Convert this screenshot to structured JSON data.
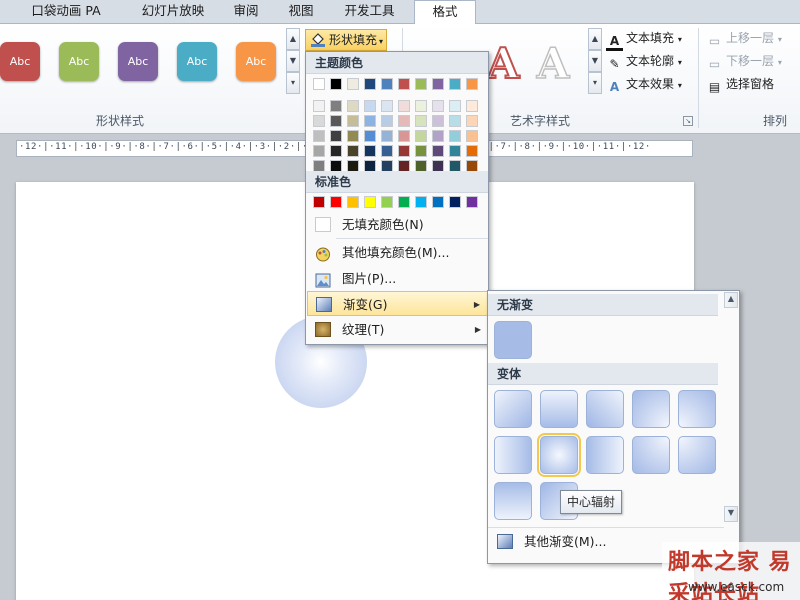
{
  "tabs": [
    {
      "label": "口袋动画 PA",
      "active": false
    },
    {
      "label": "幻灯片放映",
      "active": false
    },
    {
      "label": "审阅",
      "active": false
    },
    {
      "label": "视图",
      "active": false
    },
    {
      "label": "开发工具",
      "active": false
    },
    {
      "label": "格式",
      "active": true
    }
  ],
  "shape_styles": {
    "group_label": "形状样式",
    "buttons": [
      {
        "label": "Abc",
        "color": "#c0504d"
      },
      {
        "label": "Abc",
        "color": "#9bbb59"
      },
      {
        "label": "Abc",
        "color": "#8064a2"
      },
      {
        "label": "Abc",
        "color": "#4bacc6"
      },
      {
        "label": "Abc",
        "color": "#f79646"
      }
    ],
    "fill_button_label": "形状填充"
  },
  "wordart": {
    "group_label": "艺术字样式",
    "sample_glyph": "A",
    "commands": {
      "text_fill": "文本填充",
      "text_outline": "文本轮廓",
      "text_effects": "文本效果"
    }
  },
  "arrange": {
    "group_label": "排列",
    "commands": {
      "bring_forward": "上移一层",
      "send_backward": "下移一层",
      "selection_pane": "选择窗格"
    }
  },
  "ruler_text": "·12·|·11·|·10·|·9·|·8·|·7·|·6·|·5·|·4·|·3·|·2·|·1·|·0·|·1·|·2·|·3·|·4·|·5·|·6·|·7·|·8·|·9·|·10·|·11·|·12·",
  "fill_menu": {
    "theme_colors_label": "主题颜色",
    "theme_columns": [
      [
        "#ffffff",
        "#f2f2f2",
        "#d9d9d9",
        "#bfbfbf",
        "#a6a6a6",
        "#7f7f7f"
      ],
      [
        "#000000",
        "#7f7f7f",
        "#595959",
        "#404040",
        "#262626",
        "#0d0d0d"
      ],
      [
        "#eeece1",
        "#ddd9c3",
        "#c4bd97",
        "#938953",
        "#494429",
        "#1d1b10"
      ],
      [
        "#1f497d",
        "#c6d9f0",
        "#8db3e2",
        "#548dd4",
        "#17365d",
        "#0f243e"
      ],
      [
        "#4f81bd",
        "#dbe5f1",
        "#b8cce4",
        "#95b3d7",
        "#366092",
        "#244061"
      ],
      [
        "#c0504d",
        "#f2dcdb",
        "#e5b9b7",
        "#d99694",
        "#953734",
        "#632423"
      ],
      [
        "#9bbb59",
        "#ebf1dd",
        "#d7e3bc",
        "#c3d69b",
        "#76923c",
        "#4f6128"
      ],
      [
        "#8064a2",
        "#e5e0ec",
        "#ccc1d9",
        "#b2a2c7",
        "#5f497a",
        "#3f3151"
      ],
      [
        "#4bacc6",
        "#dbeef3",
        "#b7dde8",
        "#92cddc",
        "#31859b",
        "#205867"
      ],
      [
        "#f79646",
        "#fdeada",
        "#fbd5b5",
        "#fac08f",
        "#e36c09",
        "#974806"
      ]
    ],
    "standard_colors_label": "标准色",
    "standard_colors": [
      "#c00000",
      "#ff0000",
      "#ffc000",
      "#ffff00",
      "#92d050",
      "#00b050",
      "#00b0f0",
      "#0070c0",
      "#002060",
      "#7030a0"
    ],
    "items": {
      "no_fill": "无填充颜色(N)",
      "more_colors": "其他填充颜色(M)...",
      "picture": "图片(P)...",
      "gradient": "渐变(G)",
      "texture": "纹理(T)"
    }
  },
  "gradient_menu": {
    "no_gradient_label": "无渐变",
    "variants_label": "变体",
    "more_gradients": "其他渐变(M)...",
    "tooltip": "中心辐射",
    "selected_variant": "中心辐射"
  },
  "watermark": {
    "title": "脚本之家 易采站长站",
    "url": "www.easck.com"
  }
}
